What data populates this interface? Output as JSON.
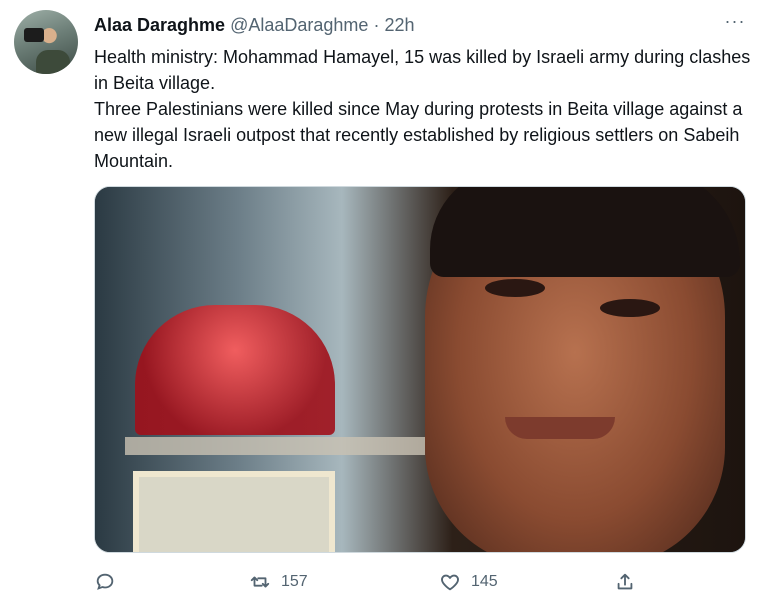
{
  "tweet": {
    "display_name": "Alaa Daraghme",
    "handle": "@AlaaDaraghme",
    "separator": "·",
    "time": "22h",
    "more_label": "···",
    "text_lines": [
      "Health ministry: Mohammad Hamayel, 15 was killed by Israeli army during clashes in Beita village.",
      "Three Palestinians were killed since May during protests in Beita village against a new illegal Israeli outpost that recently established by religious settlers on Sabeih Mountain."
    ],
    "retweets": "157",
    "likes": "145"
  },
  "icons": {
    "reply": "reply-icon",
    "retweet": "retweet-icon",
    "like": "heart-icon",
    "share": "share-icon",
    "more": "more-icon"
  },
  "colors": {
    "text": "#0f1419",
    "muted": "#536471"
  }
}
